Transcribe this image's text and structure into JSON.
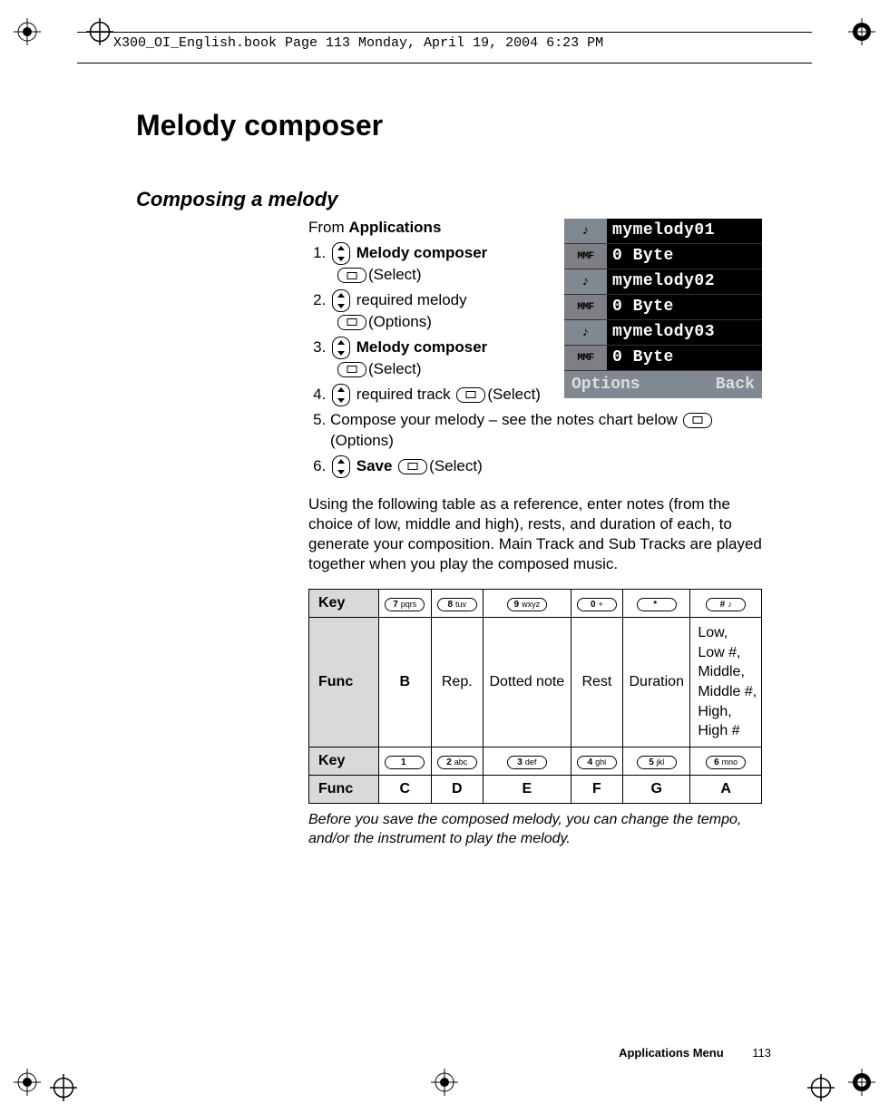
{
  "header_text": "X300_OI_English.book  Page 113  Monday, April 19, 2004  6:23 PM",
  "title": "Melody composer",
  "subtitle": "Composing a melody",
  "intro_prefix": "From ",
  "intro_bold": "Applications",
  "steps": {
    "s1_bold": "Melody composer",
    "s1_line2": "(Select)",
    "s2_text": " required melody",
    "s2_line2": "(Options)",
    "s3_bold": "Melody composer",
    "s3_line2": "(Select)",
    "s4_text": " required track ",
    "s4_suffix": "(Select)",
    "s5_text": "Compose your melody – see the notes chart below ",
    "s5_suffix": "(Options)",
    "s6_bold": "Save",
    "s6_suffix": "(Select)"
  },
  "screenshot": {
    "r1_name": "mymelody01",
    "r1_size": "0 Byte",
    "r2_name": "mymelody02",
    "r2_size": "0 Byte",
    "r3_name": "mymelody03",
    "r3_size": "0 Byte",
    "mmf": "MMF",
    "note_icon": "♪",
    "soft_left": "Options",
    "soft_right": "Back"
  },
  "paragraph": "Using the following table as a reference, enter notes (from the choice of low, middle and high), rests, and duration of each, to generate your composition. Main Track and Sub Tracks are played together when you play the composed music.",
  "table": {
    "key_label": "Key",
    "func_label": "Func",
    "keys_row1": {
      "k1": "7",
      "k1s": "pqrs",
      "k2": "8",
      "k2s": "tuv",
      "k3": "9",
      "k3s": "wxyz",
      "k4": "0",
      "k4s": "+",
      "k5": "*",
      "k5s": "",
      "k6": "#",
      "k6s": "♪"
    },
    "func_row1": {
      "f1": "B",
      "f2": "Rep.",
      "f3": "Dotted note",
      "f4": "Rest",
      "f5": "Duration",
      "f6": "Low,\nLow #,\nMiddle,\nMiddle #,\nHigh,\nHigh #"
    },
    "keys_row2": {
      "k1": "1",
      "k1s": "",
      "k2": "2",
      "k2s": "abc",
      "k3": "3",
      "k3s": "def",
      "k4": "4",
      "k4s": "ghi",
      "k5": "5",
      "k5s": "jkl",
      "k6": "6",
      "k6s": "mno"
    },
    "func_row2": {
      "f1": "C",
      "f2": "D",
      "f3": "E",
      "f4": "F",
      "f5": "G",
      "f6": "A"
    }
  },
  "footnote": "Before you save the composed melody, you can change the tempo, and/or the instrument to play the melody.",
  "footer_label": "Applications Menu",
  "footer_page": "113"
}
